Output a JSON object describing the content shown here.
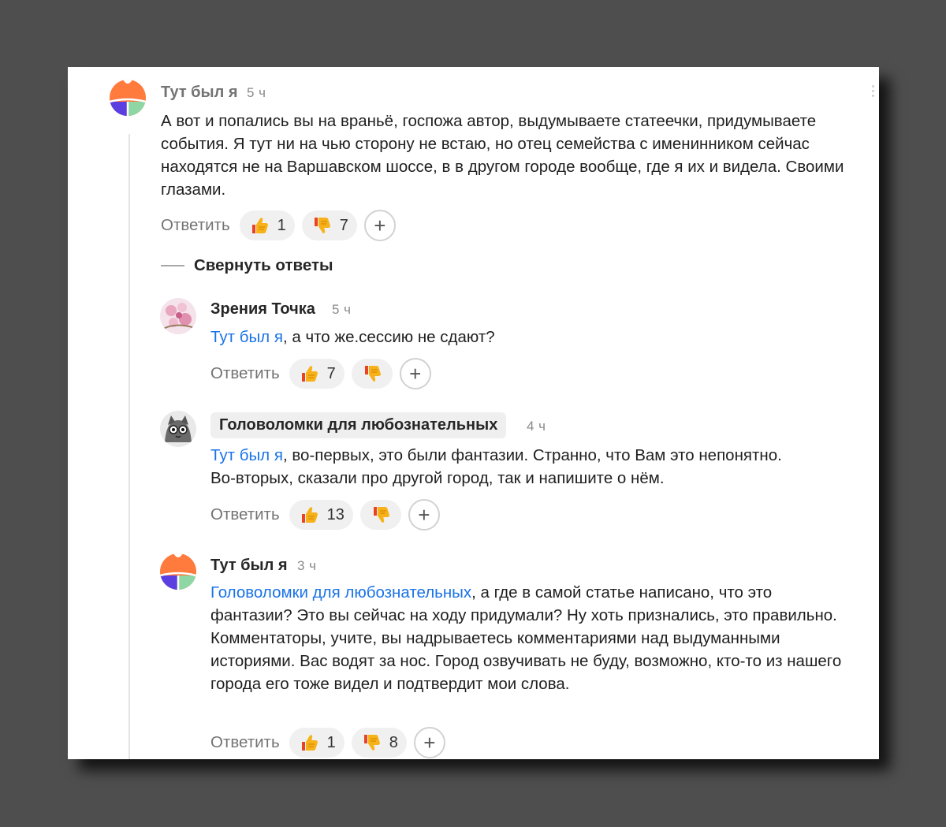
{
  "colors": {
    "page_bg": "#4e4e4e",
    "mention": "#1a73e8",
    "card": "#ffffff"
  },
  "collapse_label": "Свернуть ответы",
  "comments": [
    {
      "author": "Тут был я",
      "time": "5 ч",
      "avatar": "yandex-default-avatar",
      "text": "А вот и попались вы на враньё, госпожа автор, выдумываете статеечки, придумываете события. Я тут ни на чью сторону не встаю, но отец семейства с именинником сейчас находятся не на Варшавском шоссе, в в другом городе вообще, где я их и видела. Своими глазами.",
      "reply_label": "Ответить",
      "likes": "1",
      "dislikes": "7"
    },
    {
      "author": "Зрения Точка",
      "time": "5 ч",
      "avatar": "sakura-photo-avatar",
      "mention": "Тут был я",
      "text": ", а что же.сессию не сдают?",
      "reply_label": "Ответить",
      "likes": "7",
      "dislikes": ""
    },
    {
      "author": "Головоломки для любознательных",
      "time": "4 ч",
      "avatar": "cat-drawing-avatar",
      "mention": "Тут был я",
      "text_line1": ", во-первых, это были фантазии. Странно, что Вам это непонятно.",
      "text_line2": "Во-вторых, сказали про другой город, так и напишите о нём.",
      "reply_label": "Ответить",
      "likes": "13",
      "dislikes": ""
    },
    {
      "author": "Тут был я",
      "time": "3 ч",
      "avatar": "yandex-default-avatar",
      "mention": "Головоломки для любознательных",
      "text_line1": ", а где в самой статье написано, что это",
      "text_rest": "фантазии? Это вы сейчас на ходу придумали? Ну хоть признались, это правильно. Комментаторы, учите, вы надрываетесь комментариями над выдуманными историями. Вас водят за нос. Город озвучивать не буду, возможно, кто-то из нашего города его тоже видел и подтвердит мои слова.",
      "reply_label": "Ответить",
      "likes": "1",
      "dislikes": "8"
    }
  ]
}
